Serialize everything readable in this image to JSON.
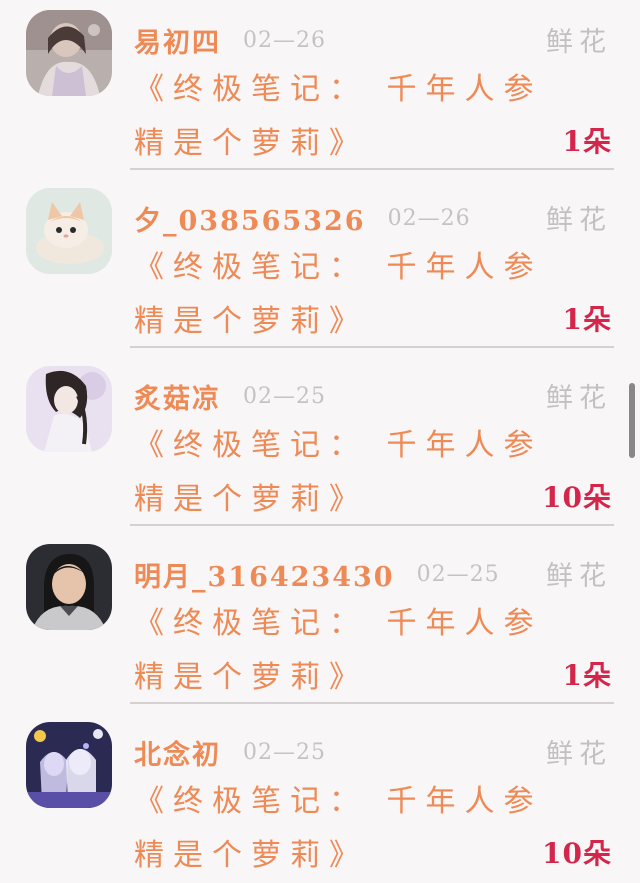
{
  "list": {
    "items": [
      {
        "username": "易初四",
        "date": "02—26",
        "gift_type": "鲜花",
        "book_line1": "《终极笔记： 千年人参",
        "book_line2": "精是个萝莉》",
        "count": "1朵",
        "avatar_icon": "avatar-girl-hanfu-icon"
      },
      {
        "username": "夕_038565326",
        "date": "02—26",
        "gift_type": "鲜花",
        "book_line1": "《终极笔记： 千年人参",
        "book_line2": "精是个萝莉》",
        "count": "1朵",
        "avatar_icon": "avatar-kitten-icon"
      },
      {
        "username": "炙菇凉",
        "date": "02—25",
        "gift_type": "鲜花",
        "book_line1": "《终极笔记： 千年人参",
        "book_line2": "精是个萝莉》",
        "count": "10朵",
        "avatar_icon": "avatar-anime-girl-icon"
      },
      {
        "username": "明月_316423430",
        "date": "02—25",
        "gift_type": "鲜花",
        "book_line1": "《终极笔记： 千年人参",
        "book_line2": "精是个萝莉》",
        "count": "1朵",
        "avatar_icon": "avatar-portrait-icon"
      },
      {
        "username": "北念初",
        "date": "02—25",
        "gift_type": "鲜花",
        "book_line1": "《终极笔记： 千年人参",
        "book_line2": "精是个萝莉》",
        "count": "10朵",
        "avatar_icon": "avatar-anime-group-icon"
      }
    ]
  },
  "colors": {
    "name_orange": "#ee8a55",
    "count_red": "#d4254a",
    "muted_gray": "#c3c0c1",
    "background": "#f8f6f7"
  }
}
